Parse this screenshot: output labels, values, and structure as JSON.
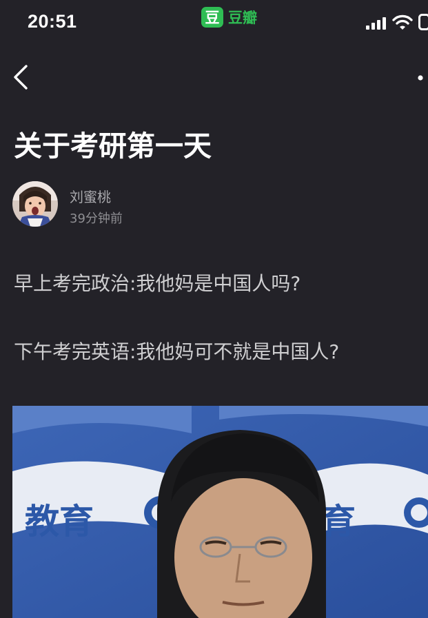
{
  "status_bar": {
    "time": "20:51",
    "app_badge_glyph": "豆",
    "app_name": "豆瓣",
    "icons": [
      "signal-icon",
      "wifi-icon",
      "battery-icon"
    ]
  },
  "nav": {
    "back_icon": "chevron-left-icon",
    "more_icon": "more-dots-icon"
  },
  "post": {
    "title": "关于考研第一天",
    "author": "刘蜜桃",
    "time": "39分钟前",
    "lines": [
      "早上考完政治:我他妈是中国人吗?",
      "下午考完英语:我他妈可不就是中国人?"
    ],
    "image_watermark": [
      "教育",
      "育"
    ]
  },
  "colors": {
    "background": "#232228",
    "accent_green": "#2fbd54",
    "title": "#ffffff",
    "body_text": "#cfcfd1",
    "meta_text": "#8f8f93"
  }
}
